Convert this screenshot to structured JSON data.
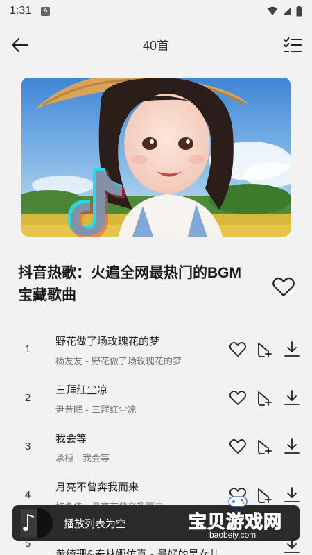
{
  "status": {
    "time": "1:31",
    "notif_glyph": "A"
  },
  "header": {
    "title": "40首",
    "back_icon": "arrow-left-icon",
    "multi_icon": "checklist-icon"
  },
  "playlist": {
    "title": "抖音热歌：火遍全网最热门的BGM宝藏歌曲"
  },
  "tracks": [
    {
      "num": "1",
      "name": "野花做了场玫瑰花的梦",
      "sub": "杨友友 - 野花做了场玫瑰花的梦"
    },
    {
      "num": "2",
      "name": "三拜红尘凉",
      "sub": "尹昔眠 - 三拜红尘凉"
    },
    {
      "num": "3",
      "name": "我会等",
      "sub": "承桓 - 我会等"
    },
    {
      "num": "4",
      "name": "月亮不曾奔我而来",
      "sub": "好多债 - 月亮不曾奔我而来"
    },
    {
      "num": "5",
      "name": "黄绮珊&秦林娜仿真 - 最好的是女儿",
      "sub": ""
    }
  ],
  "player": {
    "status_text": "播放列表为空"
  },
  "watermark": {
    "main": "宝贝游戏网",
    "sub": "baobeiy.com"
  },
  "colors": {
    "background": "#f2f2f2",
    "player_bg": "#2a2a2a",
    "watermark": "#f6a21c"
  }
}
